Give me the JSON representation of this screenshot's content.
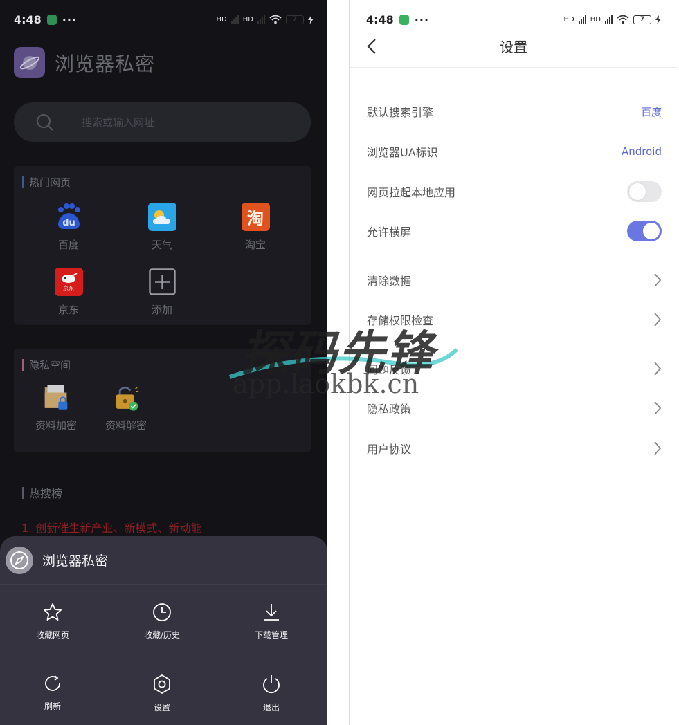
{
  "left": {
    "status": {
      "time": "4:48",
      "dots": "···",
      "hd1": "HD",
      "hd2": "HD",
      "battery": "7"
    },
    "app_name": "浏览器私密",
    "search": {
      "placeholder": "搜索或输入网址"
    },
    "hot_sites": {
      "title": "热门网页",
      "items": [
        {
          "label": "百度",
          "icon": "baidu-icon",
          "glyph": "du",
          "color": "#2b57d0"
        },
        {
          "label": "天气",
          "icon": "weather-icon",
          "color": "#2aa5e8"
        },
        {
          "label": "淘宝",
          "icon": "taobao-icon",
          "glyph": "淘",
          "color": "#e0531f"
        },
        {
          "label": "京东",
          "icon": "jd-icon",
          "glyph": "京东",
          "color": "#d51e1b"
        },
        {
          "label": "添加",
          "icon": "add-icon"
        }
      ]
    },
    "privacy": {
      "title": "隐私空间",
      "items": [
        {
          "label": "资料加密",
          "icon": "folder-lock-icon"
        },
        {
          "label": "资料解密",
          "icon": "unlock-icon"
        }
      ]
    },
    "hot_search": {
      "title": "热搜榜",
      "items": [
        "1. 创新催生新产业、新模式、新动能"
      ]
    },
    "sheet": {
      "title": "浏览器私密",
      "actions": [
        {
          "label": "收藏网页",
          "icon": "star-icon"
        },
        {
          "label": "收藏/历史",
          "icon": "clock-icon"
        },
        {
          "label": "下载管理",
          "icon": "download-icon"
        },
        {
          "label": "刷新",
          "icon": "refresh-icon"
        },
        {
          "label": "设置",
          "icon": "settings-icon"
        },
        {
          "label": "退出",
          "icon": "power-icon"
        }
      ]
    }
  },
  "right": {
    "status": {
      "time": "4:48",
      "dots": "···",
      "hd1": "HD",
      "hd2": "HD",
      "battery": "7"
    },
    "title": "设置",
    "rows": [
      {
        "label": "默认搜索引擎",
        "value": "百度"
      },
      {
        "label": "浏览器UA标识",
        "value": "Android"
      },
      {
        "label": "网页拉起本地应用",
        "toggle": false
      },
      {
        "label": "允许横屏",
        "toggle": true
      },
      {
        "label": "清除数据"
      },
      {
        "label": "存储权限检查"
      },
      {
        "label": "问题反馈"
      },
      {
        "label": "隐私政策"
      },
      {
        "label": "用户协议"
      }
    ]
  },
  "watermark": {
    "title": "探码先锋",
    "url": "app.laokbk.cn"
  },
  "colors": {
    "accent": "#6a77e3",
    "link": "#5c6bd6",
    "hot": "#8a1f24",
    "dark_bg": "#121217",
    "sheet_bg": "#35333f"
  }
}
